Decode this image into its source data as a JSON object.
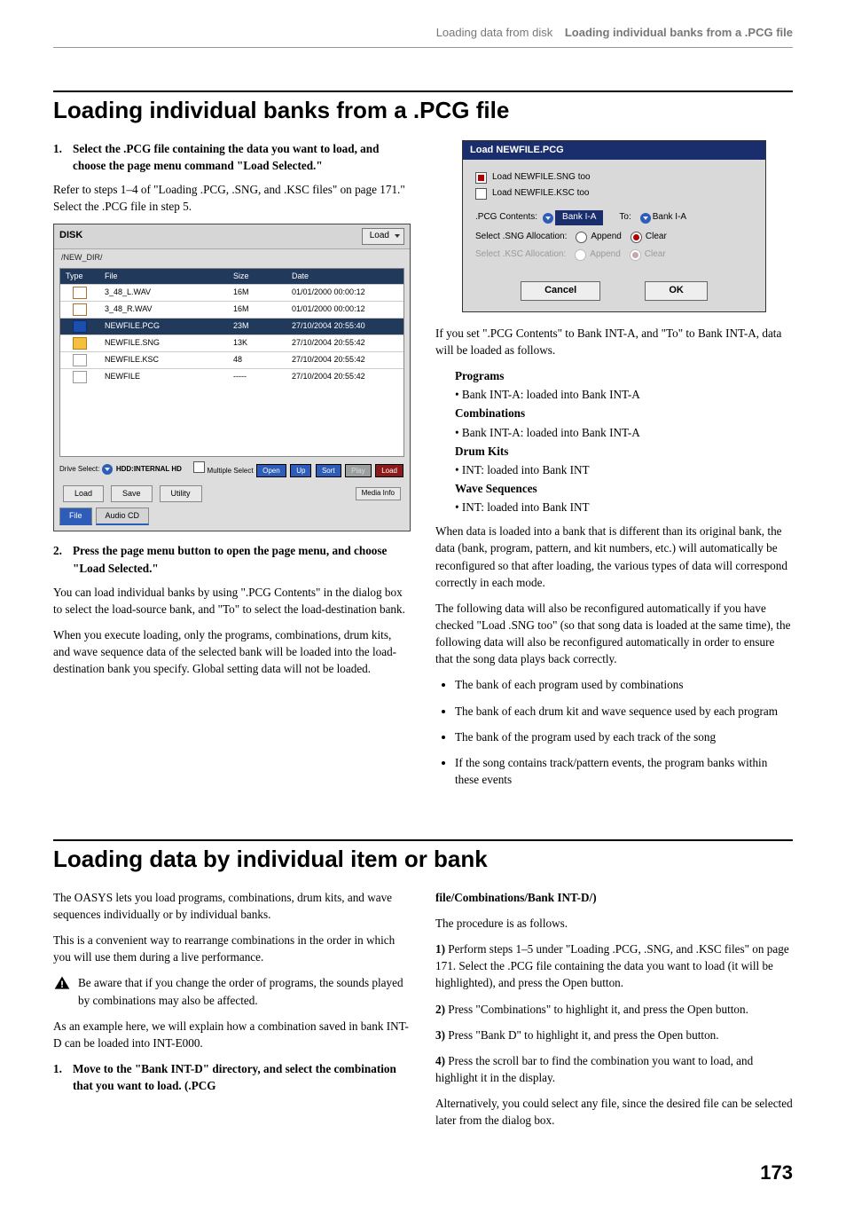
{
  "runningHead": {
    "left": "Loading data from disk",
    "right": "Loading individual banks from a .PCG file"
  },
  "h1a": "Loading individual banks from a .PCG file",
  "s1": {
    "n": "1.",
    "t": "Select the .PCG file containing the data you want to load, and choose the page menu command \"Load Selected.\"",
    "p": "Refer to steps 1–4 of \"Loading .PCG, .SNG, and .KSC files\" on page 171.\" Select the .PCG file in step 5."
  },
  "disk": {
    "title": "DISK",
    "loadBtn": "Load",
    "path": "/NEW_DIR/",
    "H": {
      "type": "Type",
      "file": "File",
      "size": "Size",
      "date": "Date"
    },
    "rows": [
      {
        "icon": "wav",
        "f": "3_48_L.WAV",
        "s": "16M",
        "d": "01/01/2000 00:00:12",
        "sel": false
      },
      {
        "icon": "wav",
        "f": "3_48_R.WAV",
        "s": "16M",
        "d": "01/01/2000 00:00:12",
        "sel": false
      },
      {
        "icon": "pcg",
        "f": "NEWFILE.PCG",
        "s": "23M",
        "d": "27/10/2004 20:55:40",
        "sel": true
      },
      {
        "icon": "sng",
        "f": "NEWFILE.SNG",
        "s": "13K",
        "d": "27/10/2004 20:55:42",
        "sel": false
      },
      {
        "icon": "ksc",
        "f": "NEWFILE.KSC",
        "s": "48",
        "d": "27/10/2004 20:55:42",
        "sel": false
      },
      {
        "icon": "gen",
        "f": "NEWFILE",
        "s": "-----",
        "d": "27/10/2004 20:55:42",
        "sel": false
      }
    ],
    "dsel": "Drive Select:",
    "dselVal": "HDD:INTERNAL HD",
    "ms": "Multiple Select",
    "btns": {
      "open": "Open",
      "up": "Up",
      "sort": "Sort",
      "play": "Play",
      "load": "Load"
    },
    "bottom": {
      "load": "Load",
      "save": "Save",
      "util": "Utility",
      "media": "Media Info"
    },
    "tabs": {
      "file": "File",
      "audio": "Audio CD"
    }
  },
  "s2": {
    "n": "2.",
    "t": "Press the page menu button to open the page menu, and choose \"Load Selected.\"",
    "p1": "You can load individual banks by using \".PCG Contents\" in the dialog box to select the load-source bank, and \"To\" to select the load-destination bank.",
    "p2": "When you execute loading, only the programs, combinations, drum kits, and wave sequence data of the selected bank will be loaded into the load-destination bank you specify. Global setting data will not be loaded."
  },
  "dialog": {
    "title": "Load NEWFILE.PCG",
    "c1": "Load NEWFILE.SNG too",
    "c2": "Load NEWFILE.KSC too",
    "pcgContents": ".PCG Contents:",
    "bank1": "Bank I-A",
    "to": "To:",
    "bank2": "Bank I-A",
    "sngAlloc": "Select .SNG Allocation:",
    "kscAlloc": "Select .KSC Allocation:",
    "append": "Append",
    "clear": "Clear",
    "cancel": "Cancel",
    "ok": "OK"
  },
  "rcol": {
    "p1": "If you set \".PCG Contents\" to Bank INT-A, and \"To\" to Bank INT-A, data will be loaded as follows.",
    "Programs": "Programs",
    "p_b": "• Bank INT-A: loaded into Bank INT-A",
    "Combinations": "Combinations",
    "c_b": "• Bank INT-A: loaded into Bank INT-A",
    "DrumKits": "Drum Kits",
    "d_b": "• INT: loaded into Bank INT",
    "WaveSeq": "Wave Sequences",
    "w_b": "• INT: loaded into Bank INT",
    "p2": "When data is loaded into a bank that is different than its original bank, the data (bank, program, pattern, and kit numbers, etc.) will automatically be reconfigured so that after loading, the various types of data will correspond correctly in each mode.",
    "p3": "The following data will also be reconfigured automatically if you have checked \"Load .SNG too\" (so that song data is loaded at the same time), the following data will also be reconfigured automatically in order to ensure that the song data plays back correctly.",
    "b": [
      "The bank of each program used by combinations",
      "The bank of each drum kit and wave sequence used by each program",
      "The bank of the program used by each track of the song",
      "If the song contains track/pattern events, the program banks within these events"
    ]
  },
  "h1b": "Loading data by individual item or bank",
  "s3": {
    "p1": "The OASYS lets you load programs, combinations, drum kits, and wave sequences individually or by individual banks.",
    "p2": "This is a convenient way to rearrange combinations in the order in which you will use them during a live performance.",
    "note": "Be aware that if you change the order of programs, the sounds played by combinations may also be affected.",
    "p3": "As an example here, we will explain how a combination saved in bank INT-D can be loaded into INT-E000.",
    "n": "1.",
    "t": "Move to the \"Bank INT-D\" directory, and select the combination that you want to load. (.PCG"
  },
  "s3r": {
    "cont": "file/Combinations/Bank INT-D/)",
    "proc": "The procedure is as follows.",
    "p1": "1) Perform steps 1–5 under \"Loading .PCG, .SNG, and .KSC files\" on page 171. Select the .PCG file containing the data you want to load (it will be highlighted), and press the Open button.",
    "p2": "2) Press \"Combinations\" to highlight it, and press the Open button.",
    "p3": "3) Press \"Bank D\" to highlight it, and press the Open button.",
    "p4": "4) Press the scroll bar to find the combination you want to load, and highlight it in the display.",
    "p5": "Alternatively, you could select any file, since the desired file can be selected later from the dialog box."
  },
  "pnum": "173"
}
